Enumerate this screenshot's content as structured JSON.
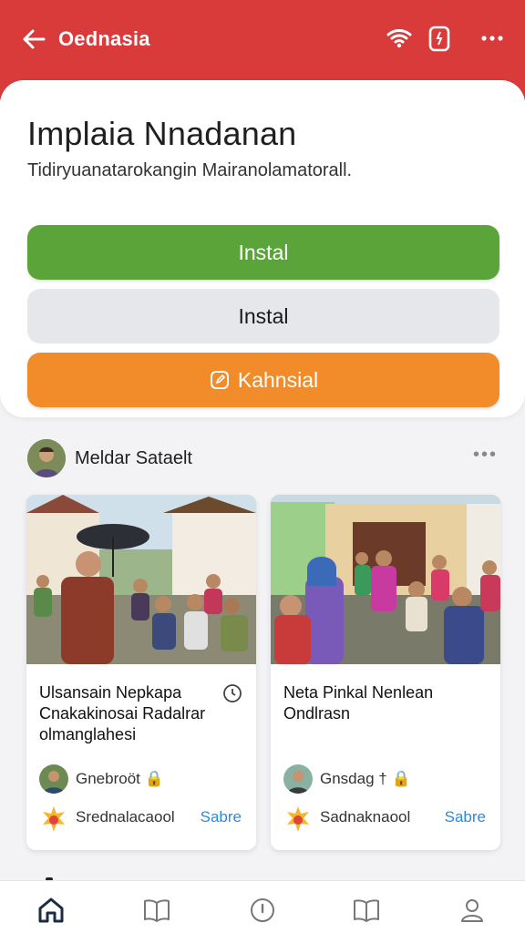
{
  "appbar": {
    "back_icon": "arrow-left-icon",
    "app_name": "Oednasia",
    "icons": [
      "wifi-icon",
      "battery-icon",
      "more-horizontal-icon"
    ],
    "color": "#d93a3a"
  },
  "header": {
    "title": "Implaia Nnadanan",
    "subtitle": "Tidiryuanatarokangin Mairanolamatorall."
  },
  "actions": {
    "primary_label": "Instal",
    "secondary_label": "Instal",
    "tertiary_label": "Kahnsial",
    "tertiary_icon": "edit-icon",
    "colors": {
      "primary": "#5ba43a",
      "secondary": "#e5e7eb",
      "tertiary": "#f28c2a"
    }
  },
  "author": {
    "name": "Meldar Sataelt",
    "more_icon": "more-horizontal-icon"
  },
  "posts": [
    {
      "title": "Ulsansain Nepkapa Cnakakinosai Radalrar olmanglahesi",
      "save_icon": "bookmark-clock-icon",
      "author": "Gnebroöt 🔒",
      "badge_icon": "sun-badge-icon",
      "subtitle": "Srednalacaool",
      "link": "Sabre"
    },
    {
      "title": "Neta Pinkal Nenlean Ondlrasn",
      "author": "Gnsdag † 🔒",
      "badge_icon": "sun-badge-icon",
      "subtitle": "Sadnaknaool",
      "link": "Sabre"
    }
  ],
  "bottom_nav": {
    "items": [
      "home-icon",
      "book-open-icon",
      "compass-icon",
      "library-icon",
      "profile-icon"
    ],
    "active": "home-icon"
  }
}
